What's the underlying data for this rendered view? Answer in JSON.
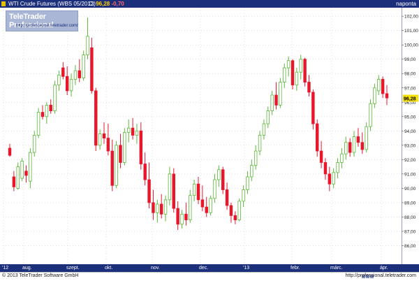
{
  "header": {
    "instrument": "WTI Crude Futures (WBS 05/2013)",
    "close_label": "C:",
    "close_value": "96,28",
    "change_value": "-0,70",
    "period": "naponta"
  },
  "logo": {
    "brand": "TeleTrader Professional",
    "url": "http://professional.teletrader.com/"
  },
  "footer": {
    "copyright": "© 2013 TeleTrader Software GmbH",
    "url": "http://professional.teletrader.com"
  },
  "colors": {
    "up_candle": "#9be36a",
    "down_candle": "#e8172b",
    "header_bg": "#1c2f7a",
    "last_price_tag": "#f6e100",
    "grid": "#c9ced8"
  },
  "chart_data": {
    "type": "candlestick",
    "ylim": [
      85,
      102
    ],
    "y_ticks": [
      "86,00",
      "87,00",
      "88,00",
      "89,00",
      "90,00",
      "91,00",
      "92,00",
      "93,00",
      "94,00",
      "95,00",
      "96,00",
      "97,00",
      "98,00",
      "99,00",
      "100,00",
      "101,00",
      "102,00"
    ],
    "x_ticks": [
      "'12",
      "aug.",
      "szept.",
      "okt.",
      "nov.",
      "dec.",
      "'13",
      "febr.",
      "márc.",
      "ápr."
    ],
    "last_price": 96.28,
    "last_price_label": "96,28",
    "grid": true,
    "candles": [
      {
        "o": 92.8,
        "h": 93.1,
        "l": 92.2,
        "c": 92.3
      },
      {
        "o": 90.8,
        "h": 91.2,
        "l": 89.8,
        "c": 90.1
      },
      {
        "o": 90.0,
        "h": 91.8,
        "l": 89.9,
        "c": 91.5
      },
      {
        "o": 90.7,
        "h": 92.1,
        "l": 90.5,
        "c": 91.9
      },
      {
        "o": 91.2,
        "h": 91.6,
        "l": 90.4,
        "c": 90.9
      },
      {
        "o": 90.5,
        "h": 92.8,
        "l": 90.0,
        "c": 92.5
      },
      {
        "o": 92.5,
        "h": 94.0,
        "l": 92.2,
        "c": 93.7
      },
      {
        "o": 93.7,
        "h": 95.6,
        "l": 93.5,
        "c": 95.3
      },
      {
        "o": 95.3,
        "h": 95.8,
        "l": 94.8,
        "c": 95.0
      },
      {
        "o": 95.0,
        "h": 96.0,
        "l": 94.5,
        "c": 95.8
      },
      {
        "o": 95.8,
        "h": 96.2,
        "l": 95.2,
        "c": 95.4
      },
      {
        "o": 95.4,
        "h": 97.5,
        "l": 95.2,
        "c": 97.2
      },
      {
        "o": 97.2,
        "h": 98.2,
        "l": 96.8,
        "c": 97.9
      },
      {
        "o": 98.4,
        "h": 98.8,
        "l": 97.6,
        "c": 97.8
      },
      {
        "o": 97.8,
        "h": 98.5,
        "l": 96.5,
        "c": 96.8
      },
      {
        "o": 96.8,
        "h": 98.0,
        "l": 96.4,
        "c": 97.6
      },
      {
        "o": 97.6,
        "h": 98.6,
        "l": 97.2,
        "c": 98.2
      },
      {
        "o": 98.2,
        "h": 99.0,
        "l": 97.4,
        "c": 97.7
      },
      {
        "o": 97.7,
        "h": 99.6,
        "l": 97.5,
        "c": 99.3
      },
      {
        "o": 99.3,
        "h": 101.9,
        "l": 99.0,
        "c": 100.6
      },
      {
        "o": 99.8,
        "h": 100.5,
        "l": 96.6,
        "c": 96.8
      },
      {
        "o": 96.8,
        "h": 97.0,
        "l": 92.6,
        "c": 93.0
      },
      {
        "o": 93.0,
        "h": 94.1,
        "l": 92.7,
        "c": 93.8
      },
      {
        "o": 93.8,
        "h": 94.6,
        "l": 93.1,
        "c": 93.5
      },
      {
        "o": 93.5,
        "h": 94.5,
        "l": 92.3,
        "c": 92.6
      },
      {
        "o": 92.6,
        "h": 93.4,
        "l": 89.8,
        "c": 90.2
      },
      {
        "o": 90.2,
        "h": 93.3,
        "l": 90.0,
        "c": 93.0
      },
      {
        "o": 93.0,
        "h": 93.8,
        "l": 91.4,
        "c": 91.8
      },
      {
        "o": 91.8,
        "h": 94.2,
        "l": 91.6,
        "c": 93.9
      },
      {
        "o": 93.9,
        "h": 94.8,
        "l": 93.2,
        "c": 94.2
      },
      {
        "o": 94.2,
        "h": 94.9,
        "l": 93.4,
        "c": 93.7
      },
      {
        "o": 93.7,
        "h": 94.5,
        "l": 93.1,
        "c": 94.0
      },
      {
        "o": 94.0,
        "h": 94.6,
        "l": 91.3,
        "c": 91.7
      },
      {
        "o": 91.7,
        "h": 92.5,
        "l": 90.2,
        "c": 90.6
      },
      {
        "o": 90.6,
        "h": 91.8,
        "l": 88.6,
        "c": 89.0
      },
      {
        "o": 89.0,
        "h": 89.9,
        "l": 87.8,
        "c": 88.3
      },
      {
        "o": 88.3,
        "h": 89.2,
        "l": 87.6,
        "c": 88.9
      },
      {
        "o": 88.9,
        "h": 89.6,
        "l": 87.9,
        "c": 88.2
      },
      {
        "o": 88.2,
        "h": 89.5,
        "l": 87.7,
        "c": 89.2
      },
      {
        "o": 89.2,
        "h": 91.5,
        "l": 88.8,
        "c": 91.0
      },
      {
        "o": 91.0,
        "h": 91.4,
        "l": 88.3,
        "c": 88.6
      },
      {
        "o": 88.6,
        "h": 89.1,
        "l": 87.1,
        "c": 87.5
      },
      {
        "o": 87.5,
        "h": 88.5,
        "l": 87.2,
        "c": 88.2
      },
      {
        "o": 88.2,
        "h": 89.0,
        "l": 87.4,
        "c": 87.8
      },
      {
        "o": 87.8,
        "h": 89.9,
        "l": 87.6,
        "c": 89.5
      },
      {
        "o": 89.5,
        "h": 90.6,
        "l": 89.1,
        "c": 90.3
      },
      {
        "o": 90.3,
        "h": 90.8,
        "l": 88.9,
        "c": 89.2
      },
      {
        "o": 89.2,
        "h": 90.2,
        "l": 88.4,
        "c": 88.7
      },
      {
        "o": 88.7,
        "h": 89.4,
        "l": 88.0,
        "c": 88.3
      },
      {
        "o": 88.3,
        "h": 89.5,
        "l": 88.1,
        "c": 89.3
      },
      {
        "o": 89.3,
        "h": 91.0,
        "l": 89.0,
        "c": 90.6
      },
      {
        "o": 90.6,
        "h": 91.6,
        "l": 90.1,
        "c": 91.3
      },
      {
        "o": 91.3,
        "h": 91.5,
        "l": 89.6,
        "c": 89.9
      },
      {
        "o": 89.9,
        "h": 90.4,
        "l": 88.5,
        "c": 88.8
      },
      {
        "o": 88.8,
        "h": 89.0,
        "l": 87.6,
        "c": 88.1
      },
      {
        "o": 88.1,
        "h": 88.4,
        "l": 87.5,
        "c": 87.8
      },
      {
        "o": 87.8,
        "h": 89.3,
        "l": 87.7,
        "c": 89.1
      },
      {
        "o": 89.1,
        "h": 90.2,
        "l": 88.7,
        "c": 89.9
      },
      {
        "o": 89.9,
        "h": 91.2,
        "l": 89.6,
        "c": 90.8
      },
      {
        "o": 90.8,
        "h": 92.0,
        "l": 90.5,
        "c": 91.6
      },
      {
        "o": 91.6,
        "h": 93.0,
        "l": 91.3,
        "c": 92.6
      },
      {
        "o": 92.6,
        "h": 94.0,
        "l": 92.3,
        "c": 93.7
      },
      {
        "o": 93.7,
        "h": 94.8,
        "l": 93.4,
        "c": 94.5
      },
      {
        "o": 94.5,
        "h": 95.7,
        "l": 94.2,
        "c": 95.4
      },
      {
        "o": 95.4,
        "h": 96.8,
        "l": 95.1,
        "c": 96.5
      },
      {
        "o": 96.5,
        "h": 97.4,
        "l": 95.5,
        "c": 95.8
      },
      {
        "o": 95.8,
        "h": 97.7,
        "l": 95.6,
        "c": 97.4
      },
      {
        "o": 97.4,
        "h": 98.7,
        "l": 97.0,
        "c": 98.4
      },
      {
        "o": 98.4,
        "h": 99.2,
        "l": 97.8,
        "c": 98.9
      },
      {
        "o": 98.9,
        "h": 99.0,
        "l": 96.9,
        "c": 97.2
      },
      {
        "o": 97.2,
        "h": 98.4,
        "l": 96.8,
        "c": 98.1
      },
      {
        "o": 98.1,
        "h": 99.3,
        "l": 97.6,
        "c": 99.0
      },
      {
        "o": 99.0,
        "h": 99.1,
        "l": 97.1,
        "c": 97.4
      },
      {
        "o": 97.4,
        "h": 97.9,
        "l": 96.4,
        "c": 96.7
      },
      {
        "o": 96.7,
        "h": 96.9,
        "l": 94.1,
        "c": 94.5
      },
      {
        "o": 94.5,
        "h": 94.8,
        "l": 92.2,
        "c": 92.6
      },
      {
        "o": 92.6,
        "h": 93.3,
        "l": 91.4,
        "c": 91.8
      },
      {
        "o": 91.8,
        "h": 92.1,
        "l": 90.6,
        "c": 91.0
      },
      {
        "o": 91.0,
        "h": 91.5,
        "l": 89.8,
        "c": 90.3
      },
      {
        "o": 90.3,
        "h": 91.4,
        "l": 90.0,
        "c": 91.1
      },
      {
        "o": 91.1,
        "h": 92.1,
        "l": 90.7,
        "c": 91.8
      },
      {
        "o": 91.8,
        "h": 92.8,
        "l": 91.4,
        "c": 92.4
      },
      {
        "o": 92.4,
        "h": 93.6,
        "l": 92.0,
        "c": 93.2
      },
      {
        "o": 93.2,
        "h": 93.5,
        "l": 92.2,
        "c": 92.5
      },
      {
        "o": 92.5,
        "h": 94.0,
        "l": 92.2,
        "c": 93.6
      },
      {
        "o": 93.6,
        "h": 94.2,
        "l": 92.9,
        "c": 93.2
      },
      {
        "o": 93.2,
        "h": 93.9,
        "l": 92.4,
        "c": 92.7
      },
      {
        "o": 92.7,
        "h": 94.6,
        "l": 92.5,
        "c": 94.3
      },
      {
        "o": 94.3,
        "h": 96.2,
        "l": 94.0,
        "c": 95.9
      },
      {
        "o": 95.9,
        "h": 97.3,
        "l": 95.6,
        "c": 97.0
      },
      {
        "o": 96.8,
        "h": 97.9,
        "l": 96.5,
        "c": 97.6
      },
      {
        "o": 97.6,
        "h": 97.8,
        "l": 96.3,
        "c": 96.6
      },
      {
        "o": 96.6,
        "h": 97.2,
        "l": 95.8,
        "c": 96.3
      }
    ]
  }
}
